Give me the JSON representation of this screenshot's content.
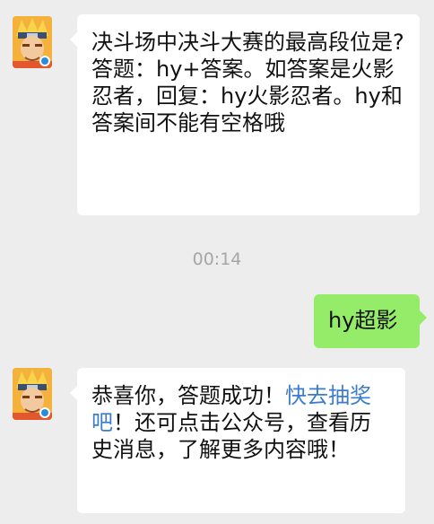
{
  "messages": [
    {
      "sender": "official-account",
      "text": "决斗场中决斗大赛的最高段位是?\n答题：hy+答案。如答案是火影忍者，回复：hy火影忍者。hy和答案间不能有空格哦"
    },
    {
      "type": "timestamp",
      "text": "00:14"
    },
    {
      "sender": "me",
      "text": "hy超影"
    },
    {
      "sender": "official-account",
      "prefix": "恭喜你，答题成功！",
      "link": "快去抽奖吧",
      "suffix": "！还可点击公众号，查看历史消息，了解更多内容哦！"
    }
  ],
  "colors": {
    "background": "#ededed",
    "incoming_bubble": "#ffffff",
    "outgoing_bubble": "#95ec69",
    "link": "#3a7dcc",
    "timestamp": "#a6a6a6"
  },
  "icons": {
    "avatar": "naruto-character-avatar"
  }
}
